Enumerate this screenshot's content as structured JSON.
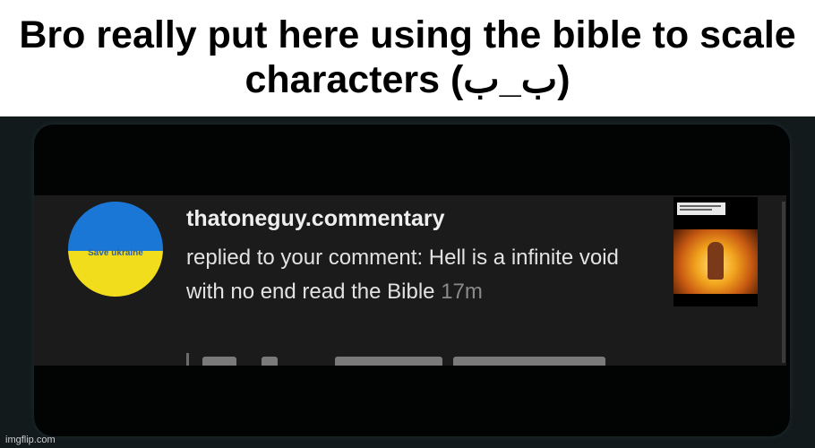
{
  "meme": {
    "caption": "Bro really put here using the bible to scale characters (ب_ب)"
  },
  "notification": {
    "avatar_label": "Save ukraine",
    "username": "thatoneguy.commentary",
    "message": "replied to your comment: Hell is a infinite void with no end read the Bible",
    "time": "17m"
  },
  "watermark": "imgflip.com",
  "colors": {
    "flag_blue": "#1b77d6",
    "flag_yellow": "#f2dd1c",
    "notification_bg": "#1b1b1b"
  }
}
